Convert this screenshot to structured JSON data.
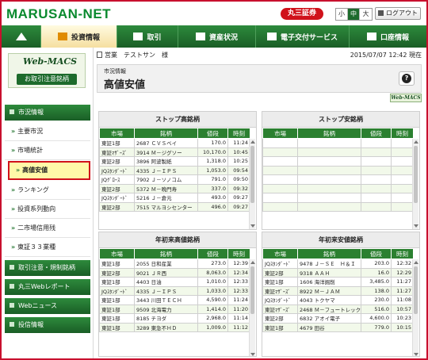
{
  "header": {
    "logo": "MARUSAN-NET",
    "brand": "丸三証券",
    "font_size": [
      "小",
      "中",
      "大"
    ],
    "font_size_selected": "中",
    "logout": "ログアウト"
  },
  "nav": {
    "items": [
      {
        "label": "",
        "icon": "home-icon"
      },
      {
        "label": "投資情報",
        "icon": "chart-icon"
      },
      {
        "label": "取引",
        "icon": "transfer-icon"
      },
      {
        "label": "資産状況",
        "icon": "coins-icon"
      },
      {
        "label": "電子交付サービス",
        "icon": "monitor-icon"
      },
      {
        "label": "口座情報",
        "icon": "account-icon"
      }
    ]
  },
  "sidebar": {
    "webmacs_logo": "Web-MACS",
    "webmacs_button": "お取引注意銘柄",
    "section_market": "市況情報",
    "items": [
      "主要市況",
      "市場統計",
      "高値安値",
      "ランキング",
      "投資系列動向",
      "二市場信用残",
      "東証３３業種"
    ],
    "sections": [
      "取引注意・規制銘柄",
      "丸三Webレポート",
      "Webニュース",
      "投信情報"
    ]
  },
  "userbar": {
    "user": "営業　テストサン　様",
    "datetime": "2015/07/07 12:42 現在"
  },
  "page": {
    "category": "市況情報",
    "title": "高値安値",
    "webmacs_mini": "Web-MACS"
  },
  "tables": {
    "columns": [
      "市場",
      "銘柄",
      "値段",
      "時刻"
    ],
    "stop_high": {
      "title": "ストップ高銘柄",
      "rows": [
        [
          "東証1部",
          "2687 ＣＶＳベイ",
          "170.0",
          "11:24"
        ],
        [
          "東証ﾏｻﾞｰｽﾞ",
          "3914 Ｍ－ジグソー",
          "10,170.0",
          "10:45"
        ],
        [
          "東証2部",
          "3896 阿波製紙",
          "1,318.0",
          "10:25"
        ],
        [
          "JQｽﾀﾝﾀﾞｰﾄﾞ",
          "4335 Ｊ－ＩＰＳ",
          "1,053.0",
          "09:54"
        ],
        [
          "JQｸﾞﾛｰｽ",
          "7902 Ｊ－ソノコム",
          "791.0",
          "09:50"
        ],
        [
          "東証2部",
          "5372 Ｍ－晩門寿",
          "337.0",
          "09:32"
        ],
        [
          "JQｽﾀﾝﾀﾞｰﾄﾞ",
          "5216 Ｊ－倉元",
          "493.0",
          "09:27"
        ],
        [
          "東証2部",
          "7515 マルヨシセンター",
          "496.0",
          "09:27"
        ]
      ]
    },
    "stop_low": {
      "title": "ストップ安銘柄",
      "rows": []
    },
    "year_high": {
      "title": "年初来高値銘柄",
      "rows": [
        [
          "東証1部",
          "2055 日和産業",
          "273.0",
          "12:39"
        ],
        [
          "東証2部",
          "9021 ＪＲ西",
          "8,063.0",
          "12:34"
        ],
        [
          "東証1部",
          "4403 日油",
          "1,010.0",
          "12:33"
        ],
        [
          "JQｽﾀﾝﾀﾞｰﾄﾞ",
          "4335 Ｊ－ＩＰＳ",
          "1,033.0",
          "12:33"
        ],
        [
          "東証1部",
          "3443 川田ＴＥＣＨ",
          "4,590.0",
          "11:24"
        ],
        [
          "東証1部",
          "9509 北海電力",
          "1,414.0",
          "11:20"
        ],
        [
          "東証1部",
          "8185 チヨダ",
          "2,968.0",
          "11:14"
        ],
        [
          "東証1部",
          "3289 東急不ＨＤ",
          "1,009.0",
          "11:12"
        ]
      ]
    },
    "year_low": {
      "title": "年初来安値銘柄",
      "rows": [
        [
          "JQｽﾀﾝﾀﾞｰﾄﾞ",
          "9478 Ｊ－ＳＥ　Ｈ＆Ｉ",
          "203.0",
          "12:32"
        ],
        [
          "東証2部",
          "9318 ＡＡＨ",
          "16.0",
          "12:29"
        ],
        [
          "東証1部",
          "1606 海洋掘削",
          "3,485.0",
          "11:27"
        ],
        [
          "東証ﾏｻﾞｰｽﾞ",
          "8922 Ｍ－ＪＡＭ",
          "138.0",
          "11:27"
        ],
        [
          "JQｽﾀﾝﾀﾞｰﾄﾞ",
          "4043 トクヤマ",
          "230.0",
          "11:08"
        ],
        [
          "東証ﾏｻﾞｰｽﾞ",
          "2468 Ｍ－フュートレック",
          "516.0",
          "10:57"
        ],
        [
          "東証2部",
          "6832 アオイ電子",
          "4,600.0",
          "10:23"
        ],
        [
          "東証1部",
          "4679 田谷",
          "779.0",
          "10:15"
        ]
      ]
    }
  }
}
